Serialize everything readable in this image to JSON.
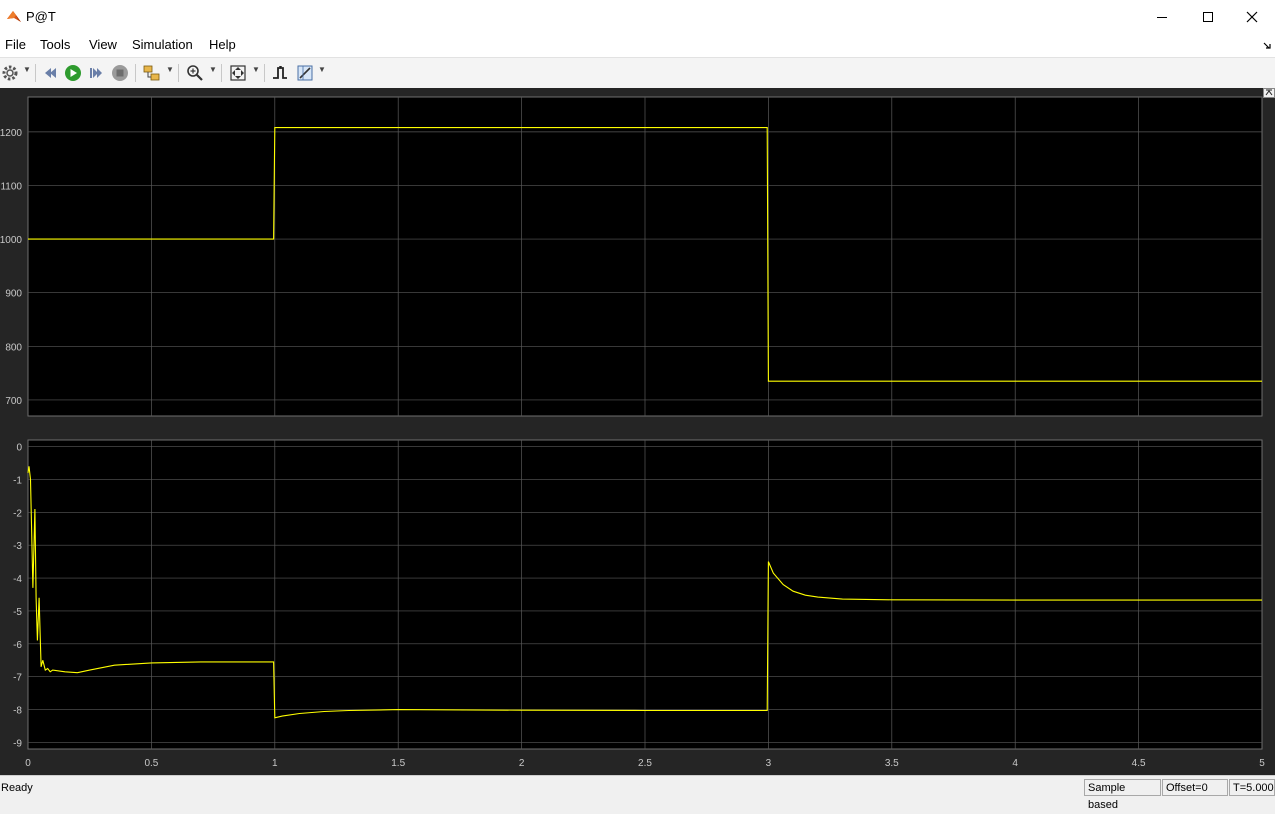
{
  "window": {
    "title": "P@T",
    "icon": "matlab-logo-icon"
  },
  "menu": [
    "File",
    "Tools",
    "View",
    "Simulation",
    "Help"
  ],
  "toolbar": {
    "icons": [
      "settings-gear-icon",
      "step-back-icon",
      "run-icon",
      "step-forward-icon",
      "stop-icon",
      "highlight-block-icon",
      "zoom-icon",
      "autoscale-icon",
      "triggers-icon",
      "cursor-measurements-icon"
    ]
  },
  "colors": {
    "plot_bg": "#000000",
    "figure_bg": "#252525",
    "signal": "#ffff00",
    "grid": "#5a5a5a"
  },
  "chart_data": [
    {
      "type": "line",
      "title": "",
      "xlabel": "",
      "ylabel": "",
      "xlim": [
        0,
        5
      ],
      "ylim": [
        670,
        1265
      ],
      "yticks": [
        700,
        800,
        900,
        1000,
        1100,
        1200
      ],
      "grid": true,
      "series": [
        {
          "x": [
            0,
            0.995,
            1.0,
            2.995,
            3.0,
            5.0
          ],
          "y": [
            1000,
            1000,
            1208,
            1208,
            735,
            735
          ]
        }
      ]
    },
    {
      "type": "line",
      "title": "",
      "xlabel": "",
      "ylabel": "",
      "xlim": [
        0,
        5
      ],
      "ylim": [
        -9.2,
        0.2
      ],
      "yticks": [
        -9,
        -8,
        -7,
        -6,
        -5,
        -4,
        -3,
        -2,
        -1,
        0
      ],
      "xticks": [
        "0",
        "0.5",
        "1",
        "1.5",
        "2",
        "2.5",
        "3",
        "3.5",
        "4",
        "4.5",
        "5"
      ],
      "grid": true,
      "series": [
        {
          "x": [
            0,
            0.004,
            0.01,
            0.02,
            0.028,
            0.033,
            0.038,
            0.045,
            0.053,
            0.06,
            0.07,
            0.08,
            0.09,
            0.1,
            0.15,
            0.2,
            0.25,
            0.35,
            0.5,
            0.7,
            0.9,
            0.995,
            1.0,
            1.03,
            1.1,
            1.2,
            1.3,
            1.5,
            2.0,
            2.5,
            2.995,
            3.0,
            3.02,
            3.06,
            3.1,
            3.15,
            3.2,
            3.3,
            3.5,
            4.0,
            5.0
          ],
          "y": [
            -0.8,
            -0.6,
            -1.0,
            -4.3,
            -1.9,
            -4.6,
            -5.9,
            -4.6,
            -6.7,
            -6.5,
            -6.8,
            -6.75,
            -6.85,
            -6.8,
            -6.85,
            -6.88,
            -6.8,
            -6.65,
            -6.58,
            -6.55,
            -6.55,
            -6.55,
            -8.25,
            -8.2,
            -8.12,
            -8.06,
            -8.03,
            -8.0,
            -8.02,
            -8.03,
            -8.03,
            -3.5,
            -3.85,
            -4.2,
            -4.4,
            -4.52,
            -4.58,
            -4.64,
            -4.66,
            -4.67,
            -4.67
          ]
        }
      ]
    }
  ],
  "status": {
    "text": "Ready",
    "sample_mode": "Sample based",
    "offset": "Offset=0",
    "time": "T=5.000"
  }
}
